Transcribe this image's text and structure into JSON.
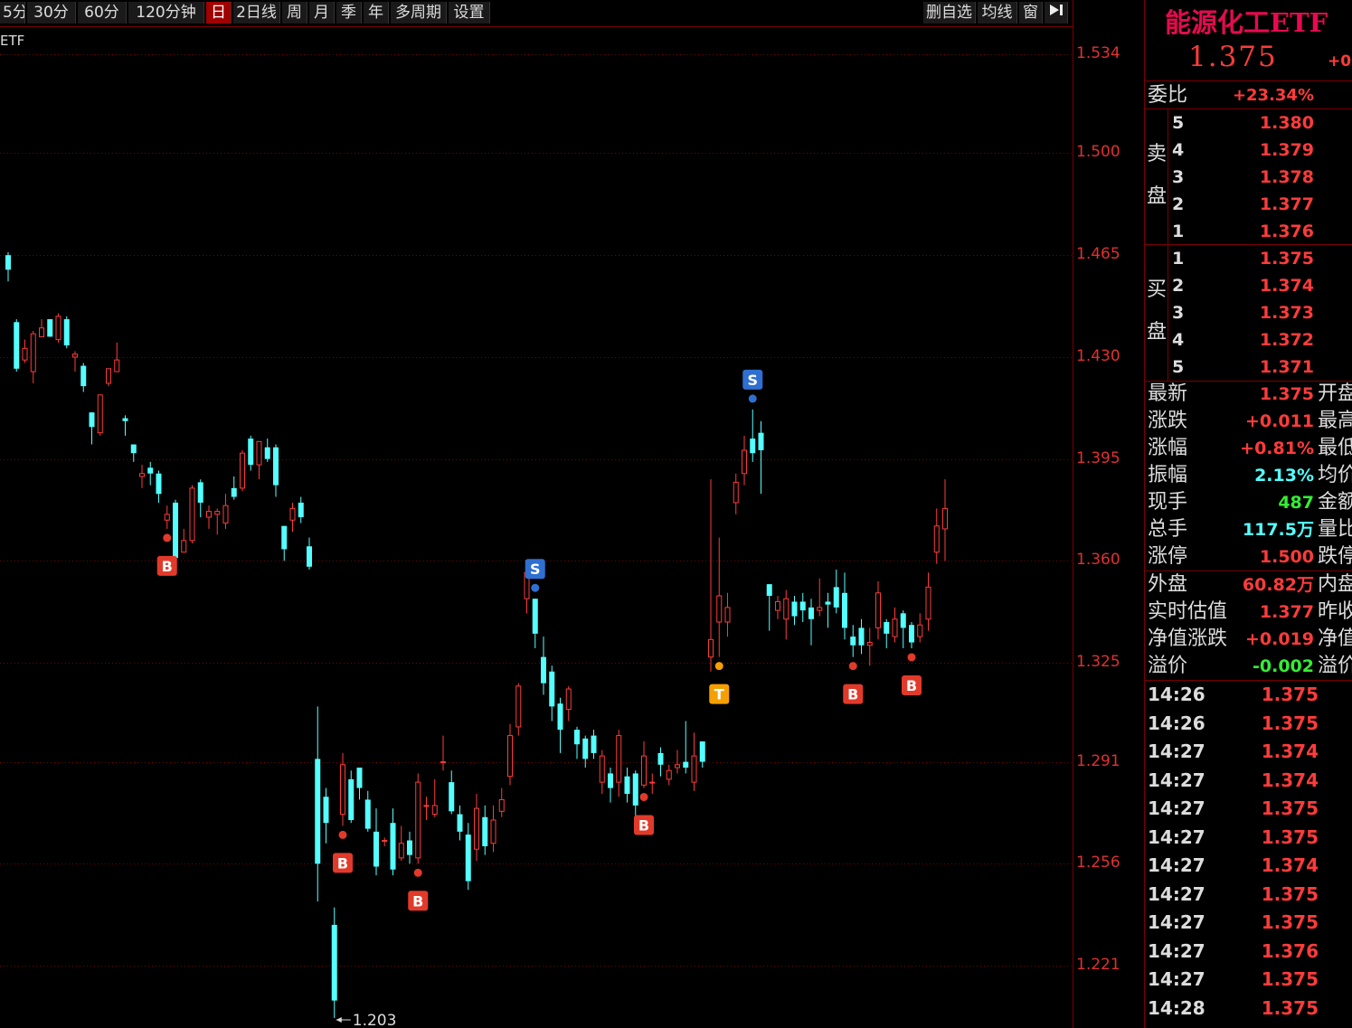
{
  "toolbar": {
    "left_items": [
      {
        "label": "5分",
        "active": false
      },
      {
        "label": "30分",
        "active": false
      },
      {
        "label": "60分",
        "active": false
      },
      {
        "label": "120分钟",
        "active": false
      },
      {
        "label": "日",
        "active": true
      },
      {
        "label": "2日线",
        "active": false
      },
      {
        "label": "周",
        "active": false
      },
      {
        "label": "月",
        "active": false
      },
      {
        "label": "季",
        "active": false
      },
      {
        "label": "年",
        "active": false
      },
      {
        "label": "多周期",
        "active": false
      },
      {
        "label": "设置",
        "active": false
      }
    ],
    "right_items": [
      {
        "label": "删自选"
      },
      {
        "label": "均线"
      },
      {
        "label": "窗"
      }
    ],
    "collapse_icon": "collapse-right-icon"
  },
  "chart": {
    "name_label": "ETF",
    "y_axis_labels": [
      "1.534",
      "1.500",
      "1.465",
      "1.430",
      "1.395",
      "1.360",
      "1.325",
      "1.291",
      "1.256",
      "1.221"
    ],
    "low_marker_label": "1.203",
    "colors": {
      "up": "#ff3b3b",
      "down": "#54ffff",
      "grid": "#7a0000",
      "buy": "#e23a2a",
      "sell": "#2f6fd1",
      "t": "#f5a000"
    }
  },
  "chart_data": {
    "type": "candlestick",
    "y_range": [
      1.203,
      1.534
    ],
    "y_ticks": [
      1.534,
      1.5,
      1.465,
      1.43,
      1.395,
      1.36,
      1.325,
      1.291,
      1.256,
      1.221
    ],
    "candles": [
      {
        "o": 1.465,
        "c": 1.46,
        "h": 1.466,
        "l": 1.456
      },
      {
        "o": 1.442,
        "c": 1.426,
        "h": 1.443,
        "l": 1.425
      },
      {
        "o": 1.429,
        "c": 1.433,
        "h": 1.436,
        "l": 1.428
      },
      {
        "o": 1.425,
        "c": 1.438,
        "h": 1.439,
        "l": 1.421
      },
      {
        "o": 1.437,
        "c": 1.44,
        "h": 1.443,
        "l": 1.437
      },
      {
        "o": 1.443,
        "c": 1.437,
        "h": 1.443,
        "l": 1.437
      },
      {
        "o": 1.436,
        "c": 1.444,
        "h": 1.445,
        "l": 1.435
      },
      {
        "o": 1.443,
        "c": 1.434,
        "h": 1.444,
        "l": 1.433
      },
      {
        "o": 1.43,
        "c": 1.431,
        "h": 1.432,
        "l": 1.425
      },
      {
        "o": 1.427,
        "c": 1.42,
        "h": 1.428,
        "l": 1.418
      },
      {
        "o": 1.411,
        "c": 1.406,
        "h": 1.411,
        "l": 1.4
      },
      {
        "o": 1.404,
        "c": 1.417,
        "h": 1.417,
        "l": 1.403
      },
      {
        "o": 1.421,
        "c": 1.426,
        "h": 1.426,
        "l": 1.42
      },
      {
        "o": 1.425,
        "c": 1.429,
        "h": 1.435,
        "l": 1.425
      },
      {
        "o": 1.409,
        "c": 1.408,
        "h": 1.41,
        "l": 1.403
      },
      {
        "o": 1.4,
        "c": 1.397,
        "h": 1.4,
        "l": 1.394
      },
      {
        "o": 1.389,
        "c": 1.39,
        "h": 1.393,
        "l": 1.385
      },
      {
        "o": 1.392,
        "c": 1.39,
        "h": 1.394,
        "l": 1.386
      },
      {
        "o": 1.39,
        "c": 1.383,
        "h": 1.391,
        "l": 1.38
      },
      {
        "o": 1.374,
        "c": 1.376,
        "h": 1.379,
        "l": 1.371
      },
      {
        "o": 1.38,
        "c": 1.361,
        "h": 1.381,
        "l": 1.36
      },
      {
        "o": 1.363,
        "c": 1.367,
        "h": 1.371,
        "l": 1.363
      },
      {
        "o": 1.367,
        "c": 1.385,
        "h": 1.386,
        "l": 1.366
      },
      {
        "o": 1.387,
        "c": 1.38,
        "h": 1.388,
        "l": 1.375
      },
      {
        "o": 1.375,
        "c": 1.377,
        "h": 1.379,
        "l": 1.371
      },
      {
        "o": 1.376,
        "c": 1.377,
        "h": 1.378,
        "l": 1.369
      },
      {
        "o": 1.373,
        "c": 1.379,
        "h": 1.383,
        "l": 1.371
      },
      {
        "o": 1.385,
        "c": 1.382,
        "h": 1.389,
        "l": 1.381
      },
      {
        "o": 1.385,
        "c": 1.397,
        "h": 1.398,
        "l": 1.384
      },
      {
        "o": 1.402,
        "c": 1.393,
        "h": 1.403,
        "l": 1.391
      },
      {
        "o": 1.393,
        "c": 1.401,
        "h": 1.401,
        "l": 1.388
      },
      {
        "o": 1.399,
        "c": 1.395,
        "h": 1.402,
        "l": 1.394
      },
      {
        "o": 1.399,
        "c": 1.386,
        "h": 1.4,
        "l": 1.382
      },
      {
        "o": 1.372,
        "c": 1.364,
        "h": 1.372,
        "l": 1.36
      },
      {
        "o": 1.374,
        "c": 1.378,
        "h": 1.38,
        "l": 1.37
      },
      {
        "o": 1.38,
        "c": 1.375,
        "h": 1.382,
        "l": 1.373
      },
      {
        "o": 1.365,
        "c": 1.358,
        "h": 1.368,
        "l": 1.357
      },
      {
        "o": 1.292,
        "c": 1.256,
        "h": 1.31,
        "l": 1.243
      },
      {
        "o": 1.279,
        "c": 1.27,
        "h": 1.282,
        "l": 1.263
      },
      {
        "o": 1.235,
        "c": 1.209,
        "h": 1.241,
        "l": 1.203
      },
      {
        "o": 1.273,
        "c": 1.29,
        "h": 1.294,
        "l": 1.269
      },
      {
        "o": 1.285,
        "c": 1.271,
        "h": 1.288,
        "l": 1.27
      },
      {
        "o": 1.289,
        "c": 1.282,
        "h": 1.289,
        "l": 1.278
      },
      {
        "o": 1.278,
        "c": 1.268,
        "h": 1.281,
        "l": 1.267
      },
      {
        "o": 1.267,
        "c": 1.255,
        "h": 1.275,
        "l": 1.252
      },
      {
        "o": 1.264,
        "c": 1.264,
        "h": 1.265,
        "l": 1.262
      },
      {
        "o": 1.27,
        "c": 1.254,
        "h": 1.275,
        "l": 1.252
      },
      {
        "o": 1.258,
        "c": 1.263,
        "h": 1.269,
        "l": 1.257
      },
      {
        "o": 1.264,
        "c": 1.259,
        "h": 1.267,
        "l": 1.256
      },
      {
        "o": 1.258,
        "c": 1.284,
        "h": 1.287,
        "l": 1.256
      },
      {
        "o": 1.276,
        "c": 1.276,
        "h": 1.279,
        "l": 1.271
      },
      {
        "o": 1.273,
        "c": 1.276,
        "h": 1.285,
        "l": 1.272
      },
      {
        "o": 1.291,
        "c": 1.291,
        "h": 1.3,
        "l": 1.288
      },
      {
        "o": 1.284,
        "c": 1.274,
        "h": 1.288,
        "l": 1.273
      },
      {
        "o": 1.273,
        "c": 1.267,
        "h": 1.276,
        "l": 1.264
      },
      {
        "o": 1.266,
        "c": 1.25,
        "h": 1.27,
        "l": 1.247
      },
      {
        "o": 1.261,
        "c": 1.275,
        "h": 1.28,
        "l": 1.257
      },
      {
        "o": 1.272,
        "c": 1.262,
        "h": 1.276,
        "l": 1.259
      },
      {
        "o": 1.263,
        "c": 1.271,
        "h": 1.276,
        "l": 1.26
      },
      {
        "o": 1.274,
        "c": 1.278,
        "h": 1.282,
        "l": 1.272
      },
      {
        "o": 1.286,
        "c": 1.3,
        "h": 1.304,
        "l": 1.283
      },
      {
        "o": 1.303,
        "c": 1.317,
        "h": 1.318,
        "l": 1.3
      },
      {
        "o": 1.347,
        "c": 1.356,
        "h": 1.359,
        "l": 1.342
      },
      {
        "o": 1.347,
        "c": 1.335,
        "h": 1.347,
        "l": 1.33
      },
      {
        "o": 1.327,
        "c": 1.318,
        "h": 1.334,
        "l": 1.314
      },
      {
        "o": 1.322,
        "c": 1.31,
        "h": 1.324,
        "l": 1.305
      },
      {
        "o": 1.311,
        "c": 1.302,
        "h": 1.313,
        "l": 1.294
      },
      {
        "o": 1.309,
        "c": 1.316,
        "h": 1.317,
        "l": 1.305
      },
      {
        "o": 1.302,
        "c": 1.297,
        "h": 1.303,
        "l": 1.292
      },
      {
        "o": 1.299,
        "c": 1.292,
        "h": 1.3,
        "l": 1.289
      },
      {
        "o": 1.3,
        "c": 1.294,
        "h": 1.302,
        "l": 1.292
      },
      {
        "o": 1.284,
        "c": 1.293,
        "h": 1.295,
        "l": 1.28
      },
      {
        "o": 1.287,
        "c": 1.282,
        "h": 1.289,
        "l": 1.277
      },
      {
        "o": 1.284,
        "c": 1.3,
        "h": 1.302,
        "l": 1.279
      },
      {
        "o": 1.286,
        "c": 1.28,
        "h": 1.289,
        "l": 1.277
      },
      {
        "o": 1.287,
        "c": 1.276,
        "h": 1.288,
        "l": 1.272
      },
      {
        "o": 1.283,
        "c": 1.293,
        "h": 1.298,
        "l": 1.282
      },
      {
        "o": 1.284,
        "c": 1.284,
        "h": 1.287,
        "l": 1.28
      },
      {
        "o": 1.294,
        "c": 1.29,
        "h": 1.296,
        "l": 1.286
      },
      {
        "o": 1.285,
        "c": 1.288,
        "h": 1.29,
        "l": 1.283
      },
      {
        "o": 1.289,
        "c": 1.29,
        "h": 1.295,
        "l": 1.287
      },
      {
        "o": 1.291,
        "c": 1.289,
        "h": 1.305,
        "l": 1.287
      },
      {
        "o": 1.284,
        "c": 1.293,
        "h": 1.301,
        "l": 1.281
      },
      {
        "o": 1.298,
        "c": 1.291,
        "h": 1.298,
        "l": 1.289
      },
      {
        "o": 1.327,
        "c": 1.333,
        "h": 1.388,
        "l": 1.322
      },
      {
        "o": 1.339,
        "c": 1.348,
        "h": 1.368,
        "l": 1.327
      },
      {
        "o": 1.339,
        "c": 1.344,
        "h": 1.349,
        "l": 1.334
      },
      {
        "o": 1.38,
        "c": 1.387,
        "h": 1.39,
        "l": 1.376
      },
      {
        "o": 1.39,
        "c": 1.398,
        "h": 1.403,
        "l": 1.386
      },
      {
        "o": 1.402,
        "c": 1.397,
        "h": 1.412,
        "l": 1.394
      },
      {
        "o": 1.404,
        "c": 1.398,
        "h": 1.408,
        "l": 1.383
      },
      {
        "o": 1.352,
        "c": 1.348,
        "h": 1.352,
        "l": 1.336
      },
      {
        "o": 1.343,
        "c": 1.346,
        "h": 1.348,
        "l": 1.34
      },
      {
        "o": 1.34,
        "c": 1.347,
        "h": 1.35,
        "l": 1.333
      },
      {
        "o": 1.346,
        "c": 1.341,
        "h": 1.348,
        "l": 1.338
      },
      {
        "o": 1.346,
        "c": 1.343,
        "h": 1.349,
        "l": 1.339
      },
      {
        "o": 1.344,
        "c": 1.34,
        "h": 1.347,
        "l": 1.331
      },
      {
        "o": 1.343,
        "c": 1.344,
        "h": 1.354,
        "l": 1.341
      },
      {
        "o": 1.346,
        "c": 1.345,
        "h": 1.349,
        "l": 1.337
      },
      {
        "o": 1.351,
        "c": 1.344,
        "h": 1.357,
        "l": 1.342
      },
      {
        "o": 1.349,
        "c": 1.337,
        "h": 1.356,
        "l": 1.333
      },
      {
        "o": 1.334,
        "c": 1.331,
        "h": 1.338,
        "l": 1.327
      },
      {
        "o": 1.337,
        "c": 1.331,
        "h": 1.34,
        "l": 1.328
      },
      {
        "o": 1.331,
        "c": 1.332,
        "h": 1.337,
        "l": 1.324
      },
      {
        "o": 1.337,
        "c": 1.349,
        "h": 1.353,
        "l": 1.333
      },
      {
        "o": 1.339,
        "c": 1.335,
        "h": 1.34,
        "l": 1.33
      },
      {
        "o": 1.334,
        "c": 1.34,
        "h": 1.344,
        "l": 1.332
      },
      {
        "o": 1.342,
        "c": 1.337,
        "h": 1.343,
        "l": 1.33
      },
      {
        "o": 1.338,
        "c": 1.332,
        "h": 1.339,
        "l": 1.33
      },
      {
        "o": 1.334,
        "c": 1.338,
        "h": 1.342,
        "l": 1.332
      },
      {
        "o": 1.34,
        "c": 1.351,
        "h": 1.356,
        "l": 1.336
      },
      {
        "o": 1.363,
        "c": 1.372,
        "h": 1.378,
        "l": 1.359
      },
      {
        "o": 1.371,
        "c": 1.378,
        "h": 1.388,
        "l": 1.36
      }
    ],
    "signals": [
      {
        "idx": 19,
        "type": "B"
      },
      {
        "idx": 40,
        "type": "B"
      },
      {
        "idx": 49,
        "type": "B"
      },
      {
        "idx": 63,
        "type": "S"
      },
      {
        "idx": 76,
        "type": "B"
      },
      {
        "idx": 85,
        "type": "T"
      },
      {
        "idx": 89,
        "type": "S"
      },
      {
        "idx": 101,
        "type": "B"
      },
      {
        "idx": 108,
        "type": "B"
      }
    ]
  },
  "panel": {
    "name": "能源化工ETF",
    "price": "1.375",
    "change_partial": "+0.",
    "weibi": {
      "label": "委比",
      "value": "+23.34%"
    },
    "sell_side": "卖盘",
    "buy_side": "买盘",
    "sell_levels": [
      {
        "level": "5",
        "price": "1.380"
      },
      {
        "level": "4",
        "price": "1.379"
      },
      {
        "level": "3",
        "price": "1.378"
      },
      {
        "level": "2",
        "price": "1.377"
      },
      {
        "level": "1",
        "price": "1.376"
      }
    ],
    "buy_levels": [
      {
        "level": "1",
        "price": "1.375"
      },
      {
        "level": "2",
        "price": "1.374"
      },
      {
        "level": "3",
        "price": "1.373"
      },
      {
        "level": "4",
        "price": "1.372"
      },
      {
        "level": "5",
        "price": "1.371"
      }
    ],
    "stats": [
      {
        "label": "最新",
        "value": "1.375",
        "color": "#ff3b3b",
        "right": "开盘"
      },
      {
        "label": "涨跌",
        "value": "+0.011",
        "color": "#ff3b3b",
        "right": "最高"
      },
      {
        "label": "涨幅",
        "value": "+0.81%",
        "color": "#ff3b3b",
        "right": "最低"
      },
      {
        "label": "振幅",
        "value": "2.13%",
        "color": "#54ffff",
        "right": "均价"
      },
      {
        "label": "现手",
        "value": "487",
        "color": "#33ee33",
        "right": "金额"
      },
      {
        "label": "总手",
        "value": "117.5万",
        "color": "#54ffff",
        "right": "量比"
      },
      {
        "label": "涨停",
        "value": "1.500",
        "color": "#ff3b3b",
        "right": "跌停"
      }
    ],
    "stats2": [
      {
        "label": "外盘",
        "value": "60.82万",
        "color": "#ff3b3b",
        "right": "内盘"
      },
      {
        "label": "实时估值",
        "value": "1.377",
        "color": "#ff3b3b",
        "right": "昨收"
      },
      {
        "label": "净值涨跌",
        "value": "+0.019",
        "color": "#ff3b3b",
        "right": "净值"
      },
      {
        "label": "溢价",
        "value": "-0.002",
        "color": "#33ee33",
        "right": "溢价"
      }
    ],
    "ticks": [
      {
        "time": "14:26",
        "price": "1.375"
      },
      {
        "time": "14:26",
        "price": "1.375"
      },
      {
        "time": "14:27",
        "price": "1.374"
      },
      {
        "time": "14:27",
        "price": "1.374"
      },
      {
        "time": "14:27",
        "price": "1.375"
      },
      {
        "time": "14:27",
        "price": "1.375"
      },
      {
        "time": "14:27",
        "price": "1.374"
      },
      {
        "time": "14:27",
        "price": "1.375"
      },
      {
        "time": "14:27",
        "price": "1.375"
      },
      {
        "time": "14:27",
        "price": "1.376"
      },
      {
        "time": "14:27",
        "price": "1.375"
      },
      {
        "time": "14:28",
        "price": "1.375"
      }
    ]
  }
}
